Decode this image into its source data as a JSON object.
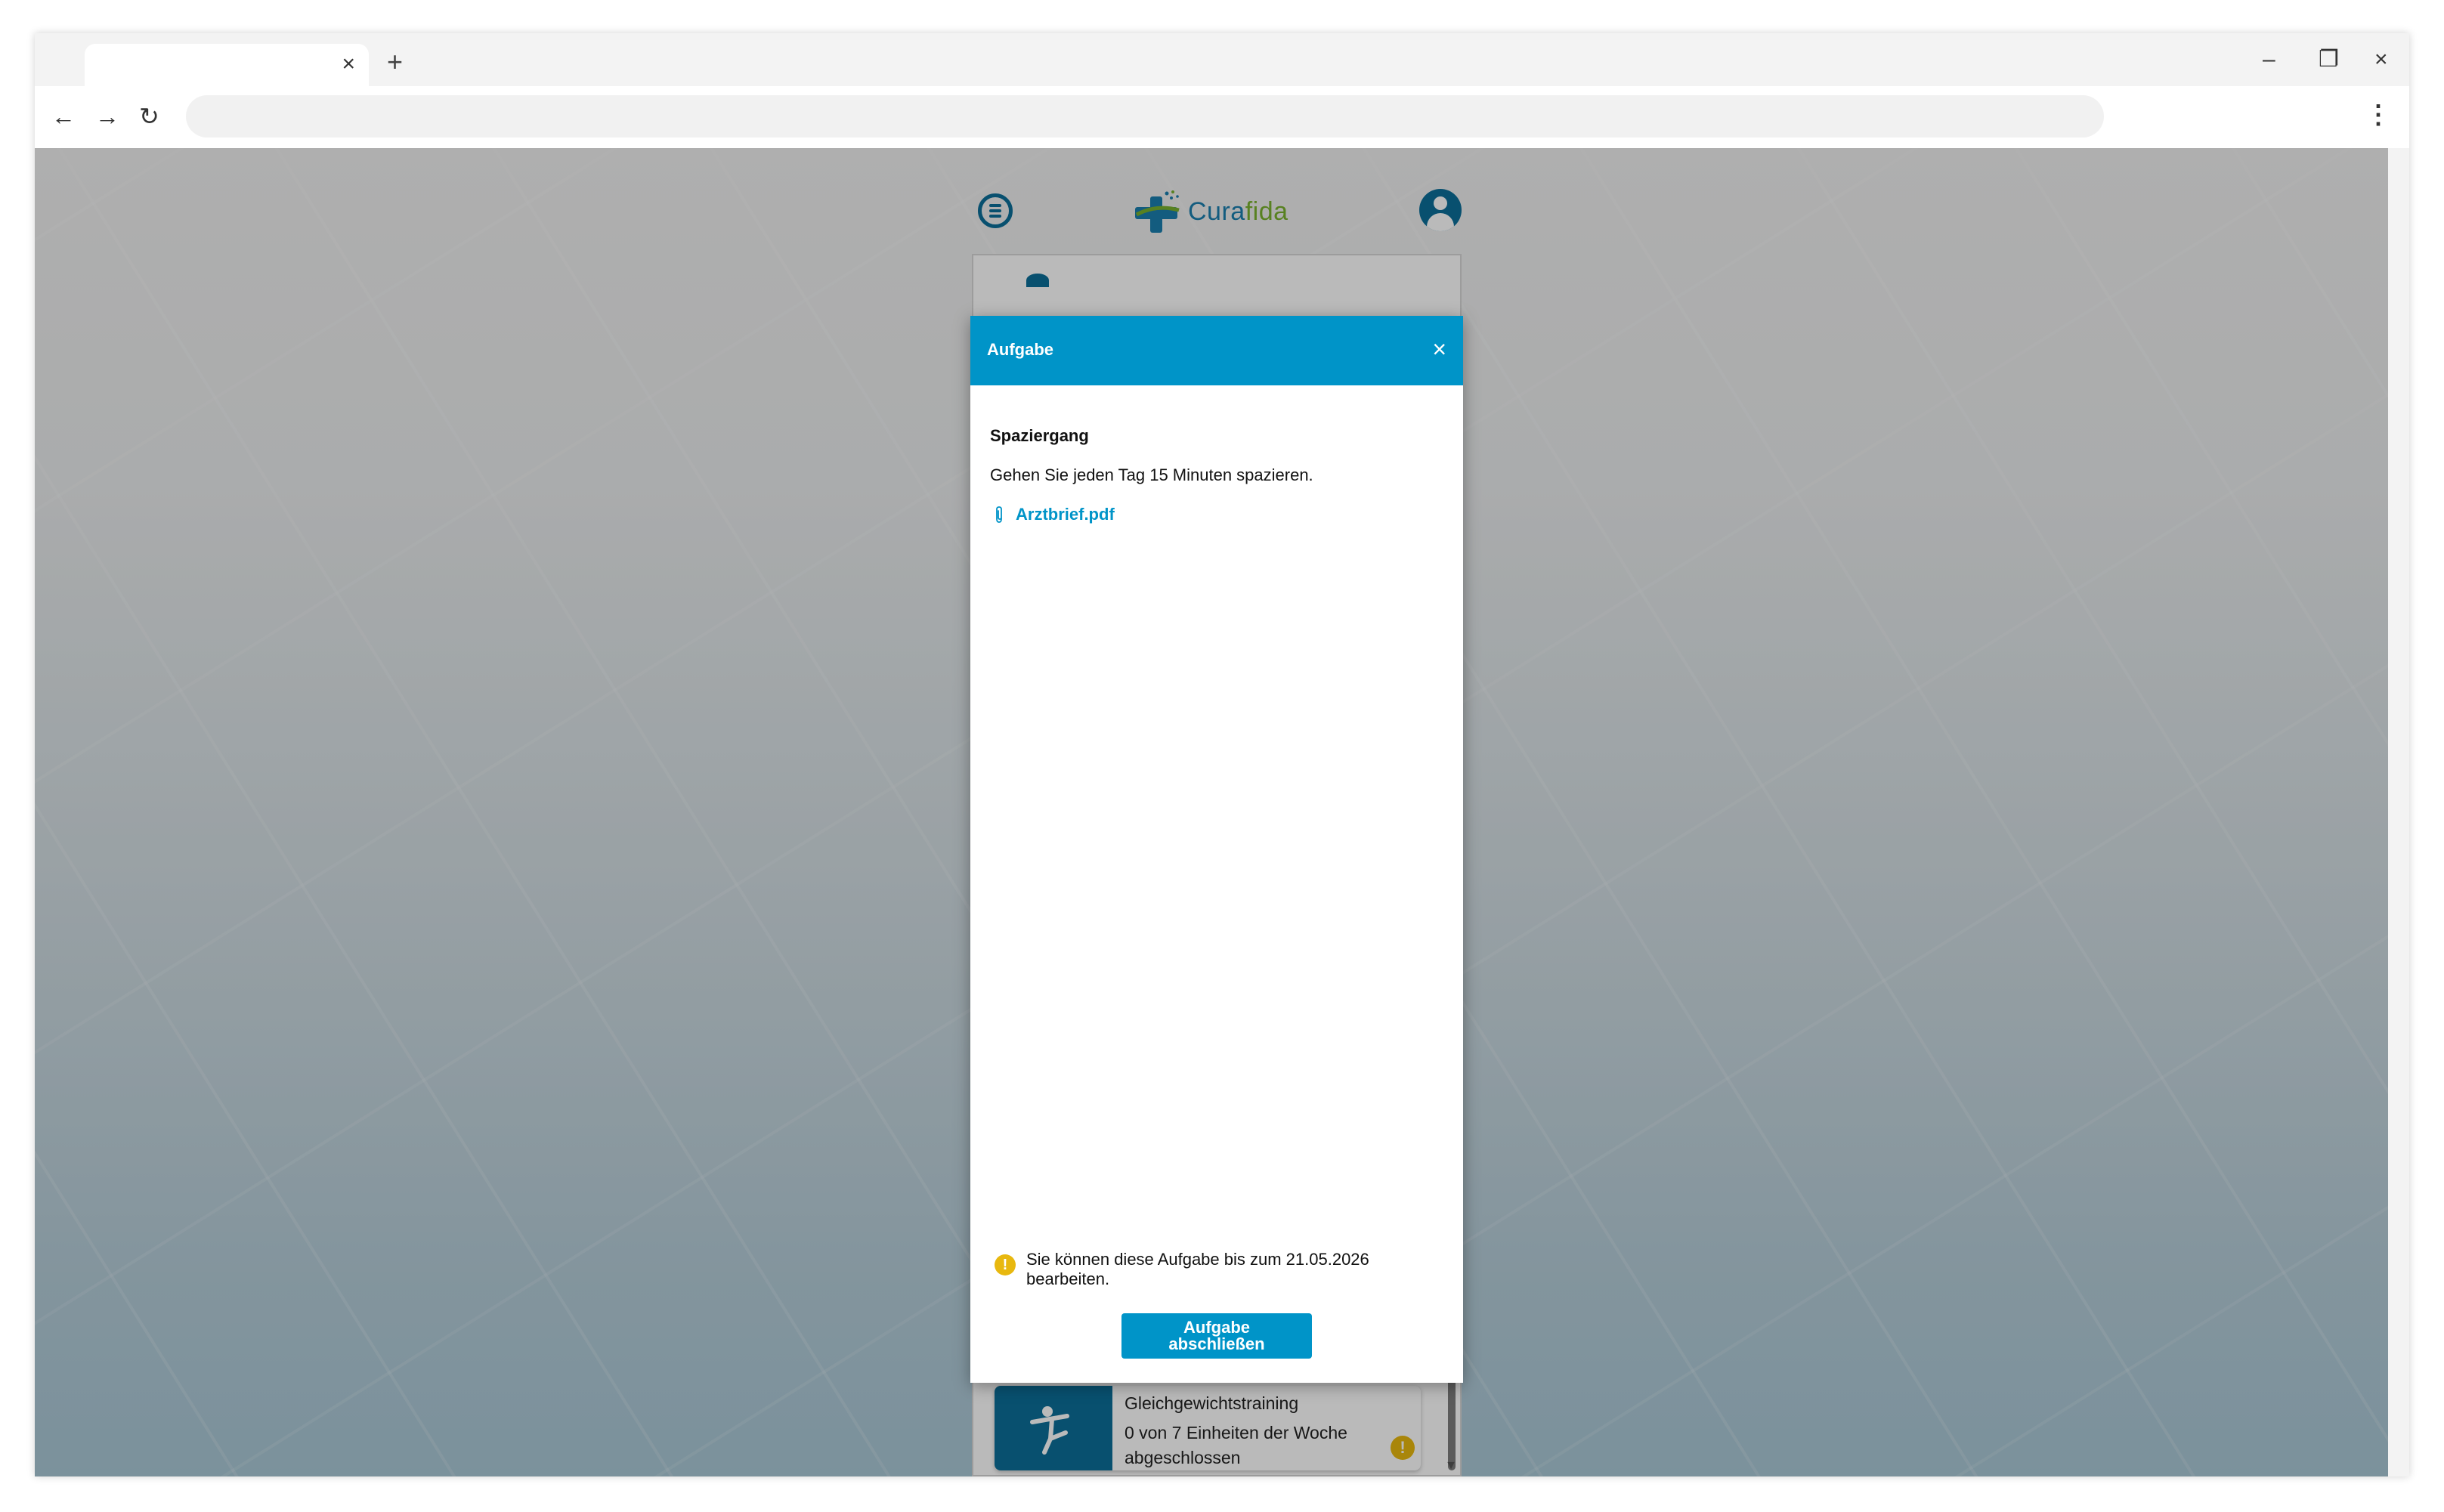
{
  "browser": {
    "tab_close": "×",
    "new_tab": "+",
    "minimize": "–",
    "restore": "❐",
    "close": "×",
    "back": "←",
    "forward": "→",
    "reload": "↻",
    "menu": "⋮"
  },
  "app": {
    "logo_part1": "Cura",
    "logo_part2": "fida",
    "brand_color": "#0c6e99",
    "accent_color": "#0094c8",
    "warning_color": "#e8b80f"
  },
  "modal": {
    "title": "Aufgabe",
    "close": "×",
    "task_title": "Spaziergang",
    "task_description": "Gehen Sie jeden Tag 15 Minuten spazieren.",
    "attachment_icon": "paperclip-icon",
    "attachment_name": "Arztbrief.pdf",
    "deadline_text": "Sie können diese Aufgabe bis zum 21.05.2026 bearbeiten.",
    "complete_button": "Aufgabe abschließen"
  },
  "task_list": [
    {
      "name": "",
      "progress": "",
      "icon": "calendar-icon",
      "warning": "!"
    },
    {
      "name": "Gleichgewichtstraining",
      "progress": "0 von 7 Einheiten der Woche abgeschlossen",
      "icon": "balance-icon",
      "warning": "!"
    }
  ]
}
